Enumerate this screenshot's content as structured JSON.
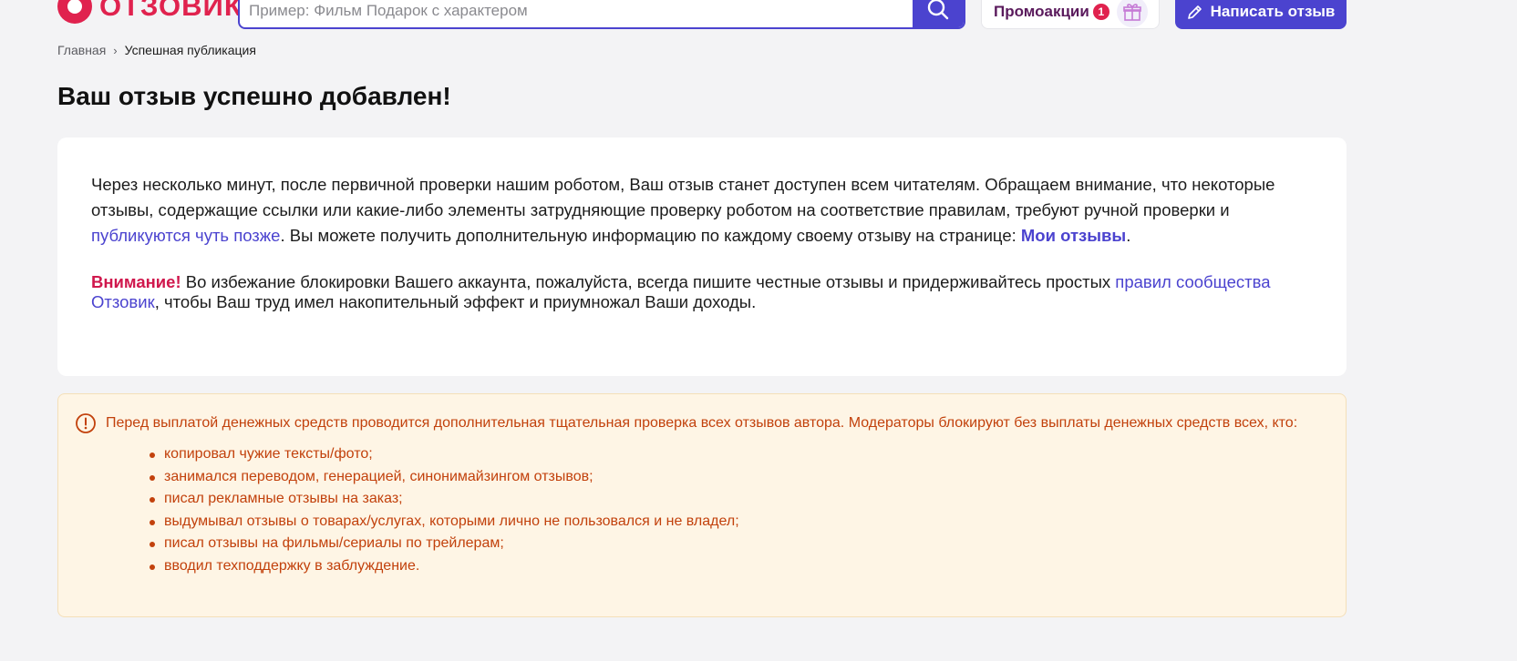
{
  "header": {
    "logo_text": "ОТЗОВИК",
    "search_placeholder": "Пример: Фильм Подарок с характером",
    "promo_label": "Промоакции",
    "promo_count": "1",
    "write_button": "Написать отзыв",
    "brand_color": "#4b43cf",
    "logo_color": "#e0224e",
    "icons": [
      "search-icon",
      "gift-icon",
      "pencil-icon"
    ]
  },
  "breadcrumb": {
    "home": "Главная",
    "separator": "›",
    "current": "Успешная публикация"
  },
  "page_title": "Ваш отзыв успешно добавлен!",
  "info": {
    "text_1": "Через несколько минут, после первичной проверки нашим роботом, Ваш отзыв станет доступен всем читателям. Обращаем внимание, что некоторые отзывы, содержащие ссылки или какие-либо элементы затрудняющие проверку роботом на соответствие правилам, требуют ручной проверки и ",
    "link_later": "публикуются чуть позже",
    "text_2": ". Вы можете получить дополнительную информацию по каждому своему отзыву на странице: ",
    "link_my_reviews": "Мои отзывы",
    "text_3": ".",
    "warning_word": "Внимание!",
    "warning_text": " Во избежание блокировки Вашего аккаунта, пожалуйста, всегда пишите честные отзывы и придерживайтесь простых ",
    "link_rules": "правил сообщества Отзовик",
    "warning_text_2": ", чтобы Ваш труд имел накопительный эффект и приумножал Ваши доходы."
  },
  "alert": {
    "icon": "exclamation-circle-icon",
    "text": "Перед выплатой денежных средств проводится дополнительная тщательная проверка всех отзывов автора. Модераторы блокируют без выплаты денежных средств всех, кто:",
    "items": [
      "копировал чужие тексты/фото;",
      "занимался переводом, генерацией, синонимайзингом отзывов;",
      "писал рекламные отзывы на заказ;",
      "выдумывал отзывы о товарах/услугах, которыми лично не пользовался и не владел;",
      "писал отзывы на фильмы/сериалы по трейлерам;",
      "вводил техподдержку в заблуждение."
    ]
  }
}
